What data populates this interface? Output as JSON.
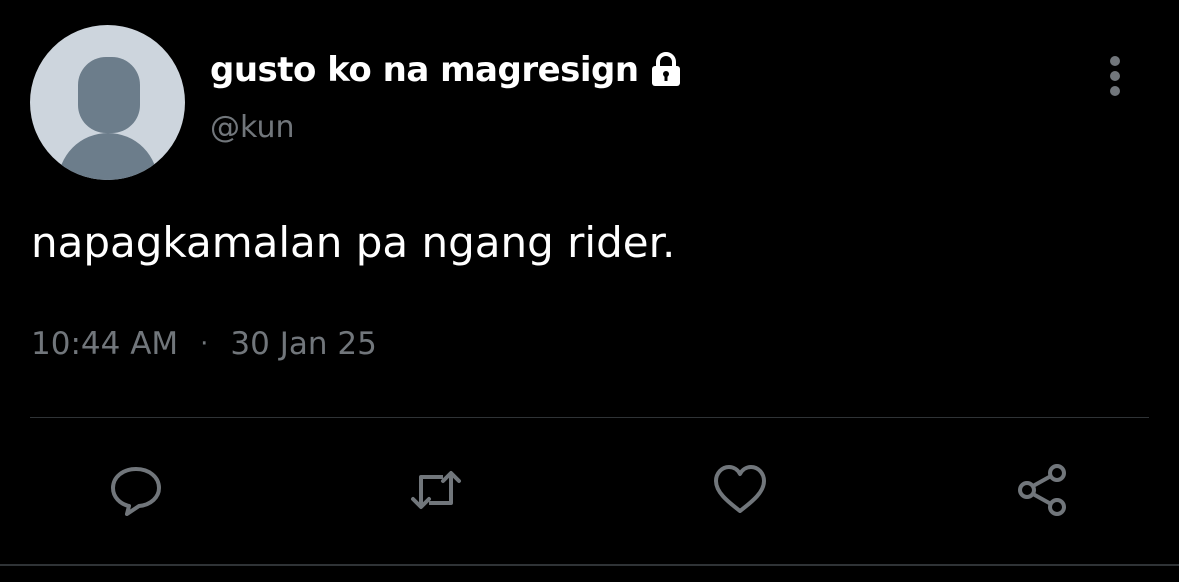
{
  "tweet": {
    "display_name": "gusto ko na magresign",
    "handle": "@kun",
    "text": "napagkamalan pa ngang rider.",
    "time": "10:44 AM",
    "separator": "·",
    "date": "30 Jan 25",
    "protected_icon": "lock-icon",
    "more_icon": "vertical-dots-icon"
  },
  "actions": [
    {
      "name": "reply",
      "icon": "reply-icon"
    },
    {
      "name": "retweet",
      "icon": "retweet-icon"
    },
    {
      "name": "like",
      "icon": "heart-icon"
    },
    {
      "name": "share",
      "icon": "share-icon"
    }
  ],
  "colors": {
    "background": "#000000",
    "text": "#ffffff",
    "secondary_text": "#71767b",
    "divider": "#2f3336",
    "avatar_bg": "#cdd5dd",
    "avatar_fg": "#6c7d8b"
  }
}
